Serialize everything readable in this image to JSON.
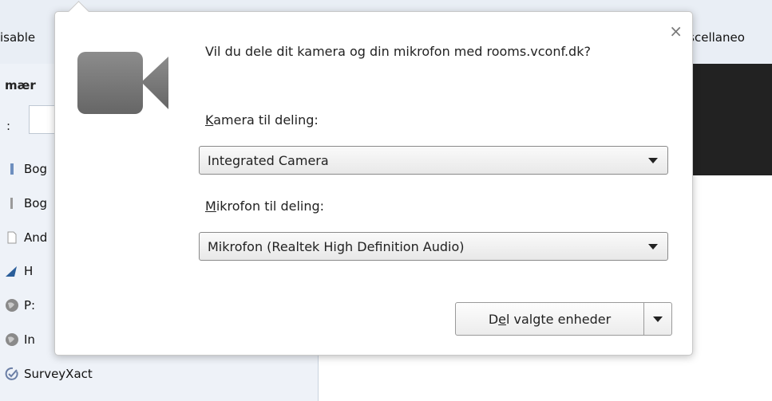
{
  "toolbar": {
    "left_text": "isable",
    "right_text": "iscellaneo"
  },
  "sidebar": {
    "heading": "mær",
    "search_label": ":",
    "items": [
      {
        "label": "Bog",
        "icon": "bookmark-page-icon"
      },
      {
        "label": "Bog",
        "icon": "bookmark-page-icon"
      },
      {
        "label": "And",
        "icon": "document-icon"
      },
      {
        "label": "H",
        "icon": "shark-fin-icon"
      },
      {
        "label": "P:",
        "icon": "globe-icon"
      },
      {
        "label": "In",
        "icon": "globe-icon"
      },
      {
        "label": "SurveyXact",
        "icon": "check-circle-icon"
      }
    ]
  },
  "popup": {
    "question": "Vil du dele dit kamera og din mikrofon med rooms.vconf.dk?",
    "close_icon": "×",
    "camera_label_accel": "K",
    "camera_label_rest": "amera til deling:",
    "camera_value": "Integrated Camera",
    "mic_label_accel": "M",
    "mic_label_rest": "ikrofon til deling:",
    "mic_value": "Mikrofon (Realtek High Definition Audio)",
    "share_pre": "D",
    "share_accel": "e",
    "share_post": "l valgte enheder"
  },
  "colors": {
    "toolbar_bg": "#e9eef5",
    "sidebar_bg": "#eef2f8",
    "dark_panel": "#222222",
    "camera_icon": "#7a7a7a"
  }
}
